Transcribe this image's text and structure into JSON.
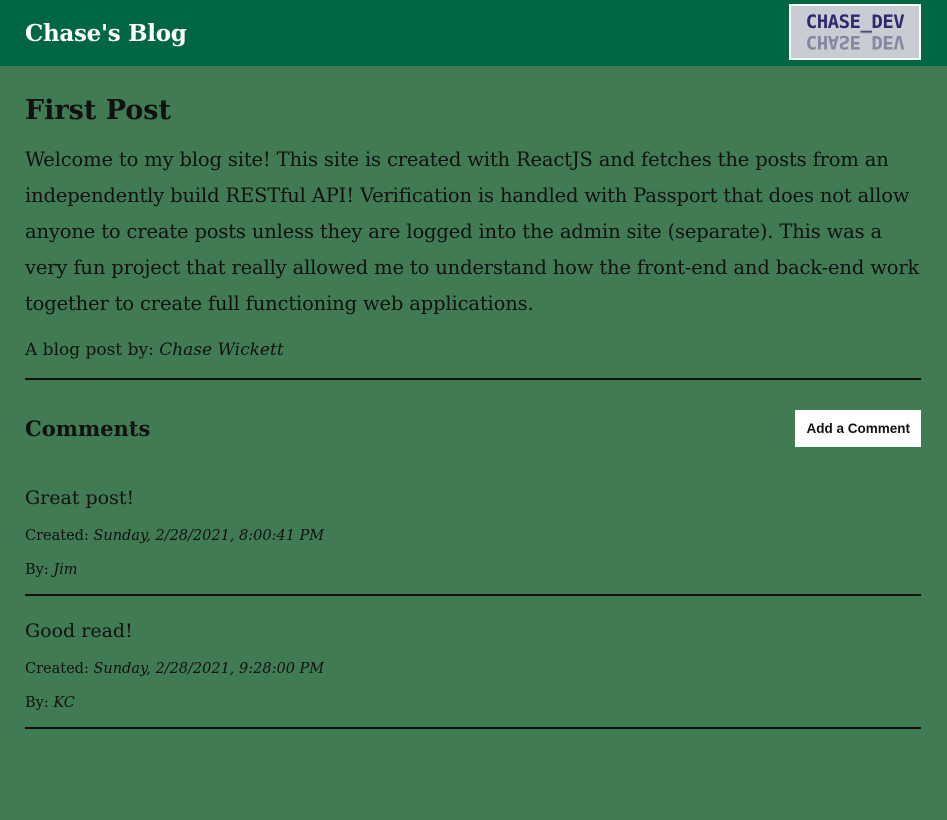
{
  "header": {
    "site_title": "Chase's Blog",
    "logo_text": "CHASE_DEV"
  },
  "post": {
    "title": "First Post",
    "body": "Welcome to my blog site! This site is created with ReactJS and fetches the posts from an independently build RESTful API! Verification is handled with Passport that does not allow anyone to create posts unless they are logged into the admin site (separate). This was a very fun project that really allowed me to understand how the front-end and back-end work together to create full functioning web applications.",
    "author_prefix": "A blog post by: ",
    "author_name": "Chase Wickett"
  },
  "comments_section": {
    "title": "Comments",
    "add_button_label": "Add a Comment",
    "created_prefix": "Created: ",
    "by_prefix": "By: ",
    "items": [
      {
        "text": "Great post!",
        "created": "Sunday, 2/28/2021, 8:00:41 PM",
        "author": "Jim"
      },
      {
        "text": "Good read!",
        "created": "Sunday, 2/28/2021, 9:28:00 PM",
        "author": "KC"
      }
    ]
  },
  "colors": {
    "header_bg": "#006644",
    "page_bg": "#417b54",
    "logo_text": "#2d2a6e"
  }
}
